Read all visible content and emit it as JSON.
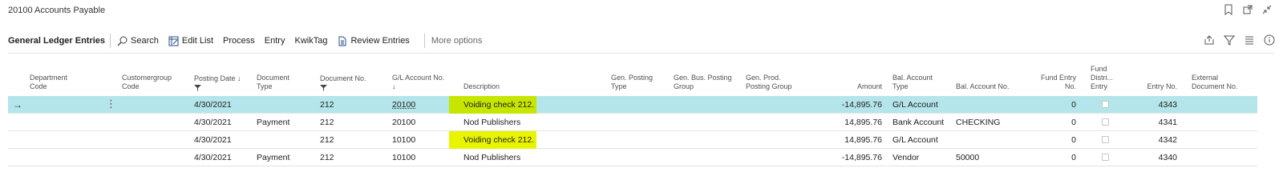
{
  "page": {
    "title": "20100 Accounts Payable"
  },
  "toolbar": {
    "title": "General Ledger Entries",
    "search": "Search",
    "edit_list": "Edit List",
    "process": "Process",
    "entry": "Entry",
    "kwiktag": "KwikTag",
    "review_entries": "Review Entries",
    "more_options": "More options"
  },
  "headers": {
    "department_code": [
      "Department",
      "Code"
    ],
    "customergroup_code": [
      "Customergroup",
      "Code"
    ],
    "posting_date": "Posting Date",
    "document_type": [
      "Document",
      "Type"
    ],
    "document_no": "Document No.",
    "gl_account_no": "G/L Account No.",
    "description": "Description",
    "gen_posting_type": [
      "Gen. Posting",
      "Type"
    ],
    "gen_bus_posting_group": [
      "Gen. Bus. Posting",
      "Group"
    ],
    "gen_prod_posting_group": [
      "Gen. Prod.",
      "Posting Group"
    ],
    "amount": "Amount",
    "bal_account_type": [
      "Bal. Account",
      "Type"
    ],
    "bal_account_no": "Bal. Account No.",
    "fund_entry_no": [
      "Fund Entry",
      "No."
    ],
    "fund_distri_entry": [
      "Fund",
      "Distri...",
      "Entry"
    ],
    "entry_no": "Entry No.",
    "external_document_no": [
      "External",
      "Document No."
    ]
  },
  "rows": [
    {
      "posting_date": "4/30/2021",
      "document_type": "",
      "document_no": "212",
      "gl_account_no": "20100",
      "description": "Voiding check 212.",
      "amount": "-14,895.76",
      "bal_account_type": "G/L Account",
      "bal_account_no": "",
      "fund_entry_no": "0",
      "entry_no": "4343"
    },
    {
      "posting_date": "4/30/2021",
      "document_type": "Payment",
      "document_no": "212",
      "gl_account_no": "20100",
      "description": "Nod Publishers",
      "amount": "14,895.76",
      "bal_account_type": "Bank Account",
      "bal_account_no": "CHECKING",
      "fund_entry_no": "0",
      "entry_no": "4341"
    },
    {
      "posting_date": "4/30/2021",
      "document_type": "",
      "document_no": "212",
      "gl_account_no": "10100",
      "description": "Voiding check 212.",
      "amount": "14,895.76",
      "bal_account_type": "G/L Account",
      "bal_account_no": "",
      "fund_entry_no": "0",
      "entry_no": "4342"
    },
    {
      "posting_date": "4/30/2021",
      "document_type": "Payment",
      "document_no": "212",
      "gl_account_no": "10100",
      "description": "Nod Publishers",
      "amount": "-14,895.76",
      "bal_account_type": "Vendor",
      "bal_account_no": "50000",
      "fund_entry_no": "0",
      "entry_no": "4340"
    }
  ],
  "colors": {
    "selected_row": "#b3e5ea",
    "highlight": "#e9f400",
    "highlight_selected": "#c6e600"
  }
}
